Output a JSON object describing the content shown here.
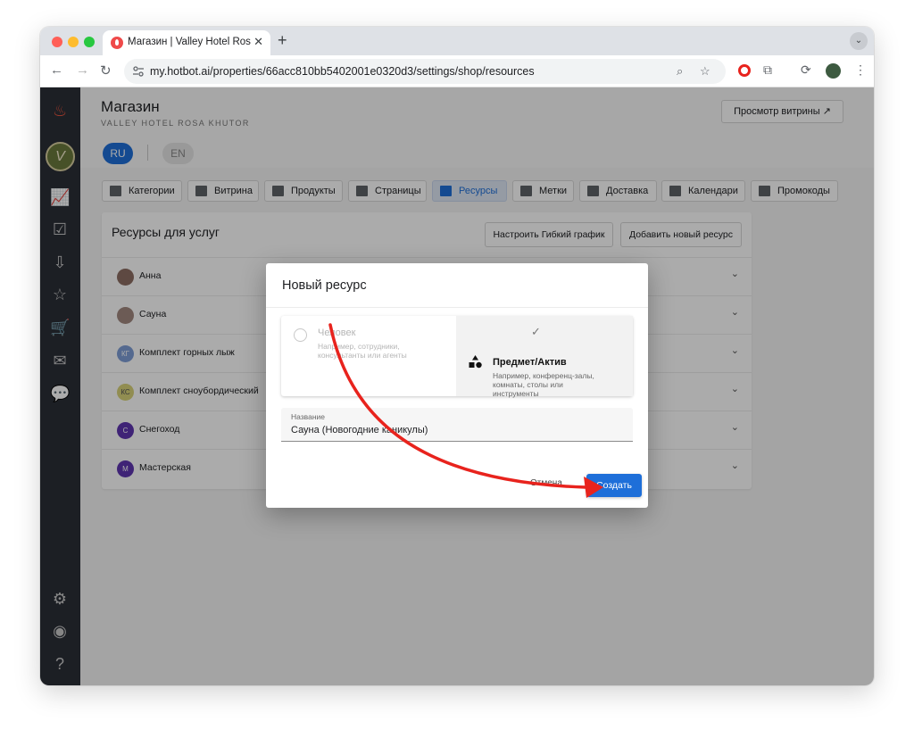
{
  "browser": {
    "tab_title": "Магазин | Valley Hotel Rosa K",
    "url": "my.hotbot.ai/properties/66acc810bb5402001e0320d3/settings/shop/resources"
  },
  "header": {
    "title": "Магазин",
    "subtitle": "VALLEY HOTEL ROSA KHUTOR",
    "preview_label": "Просмотр витрины ↗",
    "lang_ru": "RU",
    "lang_en": "EN"
  },
  "tabs": [
    {
      "label": "Категории",
      "icon": "store-icon"
    },
    {
      "label": "Витрина",
      "icon": "cards-icon"
    },
    {
      "label": "Продукты",
      "icon": "grid-icon"
    },
    {
      "label": "Страницы",
      "icon": "page-icon"
    },
    {
      "label": "Ресурсы",
      "icon": "contact-card-icon",
      "active": true
    },
    {
      "label": "Метки",
      "icon": "tag-icon"
    },
    {
      "label": "Доставка",
      "icon": "truck-icon"
    },
    {
      "label": "Календари",
      "icon": "calendar-icon"
    },
    {
      "label": "Промокоды",
      "icon": "document-icon"
    }
  ],
  "resources_panel": {
    "title": "Ресурсы для услуг",
    "flex_schedule_label": "Настроить Гибкий график",
    "add_resource_label": "Добавить новый ресурс",
    "items": [
      {
        "name": "Анна",
        "initials": "",
        "color": "#8d6e63"
      },
      {
        "name": "Сауна",
        "initials": "",
        "color": "#a1887f"
      },
      {
        "name": "Комплект горных лыж",
        "initials": "КГ",
        "color": "#7e9dd6"
      },
      {
        "name": "Комплект сноубордический",
        "initials": "КС",
        "color": "#d8d27a"
      },
      {
        "name": "Снегоход",
        "initials": "С",
        "color": "#5e35b1"
      },
      {
        "name": "Мастерская",
        "initials": "М",
        "color": "#5e35b1"
      }
    ]
  },
  "modal": {
    "title": "Новый ресурс",
    "person_label": "Человек",
    "person_desc": "Например, сотрудники, консультанты или агенты",
    "asset_label": "Предмет/Актив",
    "asset_desc": "Например, конференц-залы, комнаты, столы или инструменты",
    "name_label": "Название",
    "name_value": "Сауна (Новогодние каникулы)",
    "cancel_label": "Отмена",
    "create_label": "Создать"
  },
  "colors": {
    "accent": "#1e6fd9",
    "sidebar": "#2b2f37",
    "annotation_arrow": "#e8231d"
  }
}
